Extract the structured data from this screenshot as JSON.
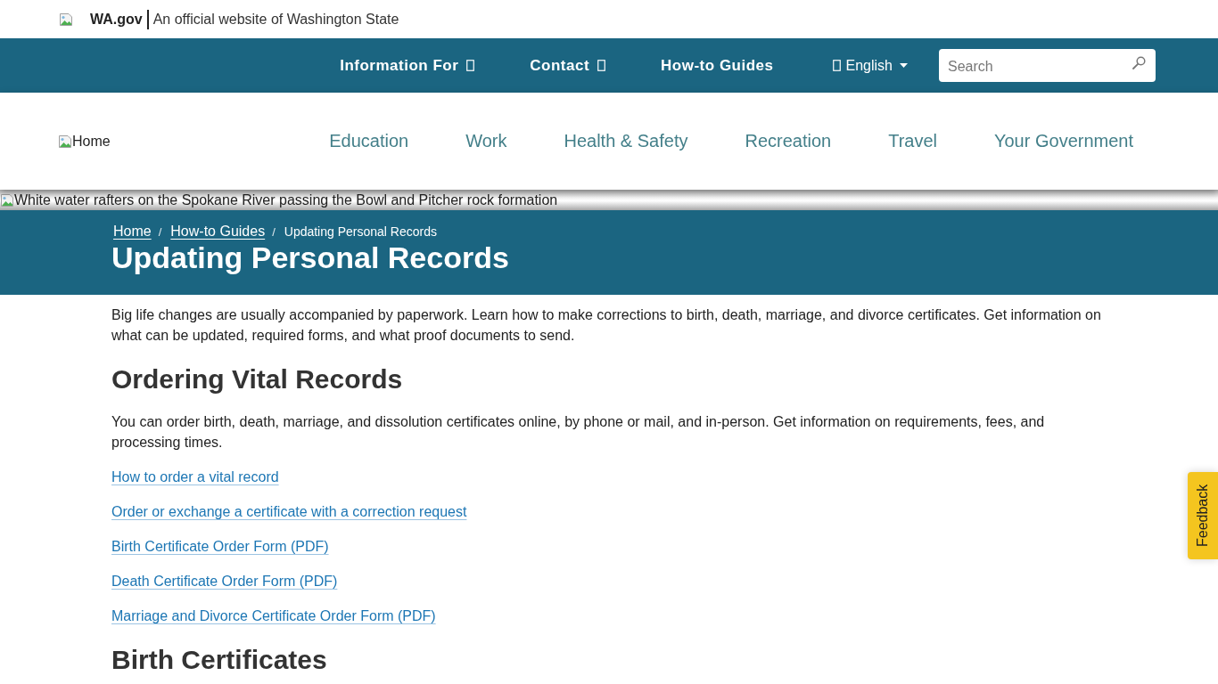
{
  "official_banner": {
    "site": "WA.gov",
    "text": "An official website of Washington State"
  },
  "utility_nav": {
    "items": [
      {
        "label": "Information For",
        "kind": "dropdown"
      },
      {
        "label": "Contact",
        "kind": "dropdown"
      },
      {
        "label": "How-to Guides",
        "kind": "link"
      }
    ],
    "language": {
      "label": "English"
    },
    "search": {
      "placeholder": "Search"
    }
  },
  "main_nav": {
    "logo_alt": "Home",
    "items": [
      "Education",
      "Work",
      "Health & Safety",
      "Recreation",
      "Travel",
      "Your Government"
    ]
  },
  "hero": {
    "alt": "White water rafters on the Spokane River passing the Bowl and Pitcher rock formation"
  },
  "page_header": {
    "breadcrumbs": [
      {
        "label": "Home",
        "kind": "link"
      },
      {
        "label": "How-to Guides",
        "kind": "link"
      },
      {
        "label": "Updating Personal Records",
        "kind": "current"
      }
    ],
    "breadcrumb_separators": [
      "/",
      "/"
    ],
    "title": "Updating Personal Records"
  },
  "content": [
    {
      "kind": "paragraph",
      "text": "Big life changes are usually accompanied by paperwork. Learn how to make corrections to birth, death, marriage, and divorce certificates. Get information on what can be updated, required forms, and what proof documents to send."
    },
    {
      "kind": "heading",
      "text": "Ordering Vital Records"
    },
    {
      "kind": "paragraph",
      "text": "You can order birth, death, marriage, and dissolution certificates online, by phone or mail, and in-person. Get information on requirements, fees, and processing times."
    },
    {
      "kind": "link",
      "text": "How to order a vital record"
    },
    {
      "kind": "link",
      "text": "Order or exchange a certificate with a correction request"
    },
    {
      "kind": "link",
      "text": "Birth Certificate Order Form (PDF)"
    },
    {
      "kind": "link",
      "text": "Death Certificate Order Form (PDF)"
    },
    {
      "kind": "link",
      "text": "Marriage and Divorce Certificate Order Form (PDF)"
    },
    {
      "kind": "heading",
      "text": "Birth Certificates"
    }
  ],
  "feedback_tab": {
    "label": "Feedback"
  }
}
